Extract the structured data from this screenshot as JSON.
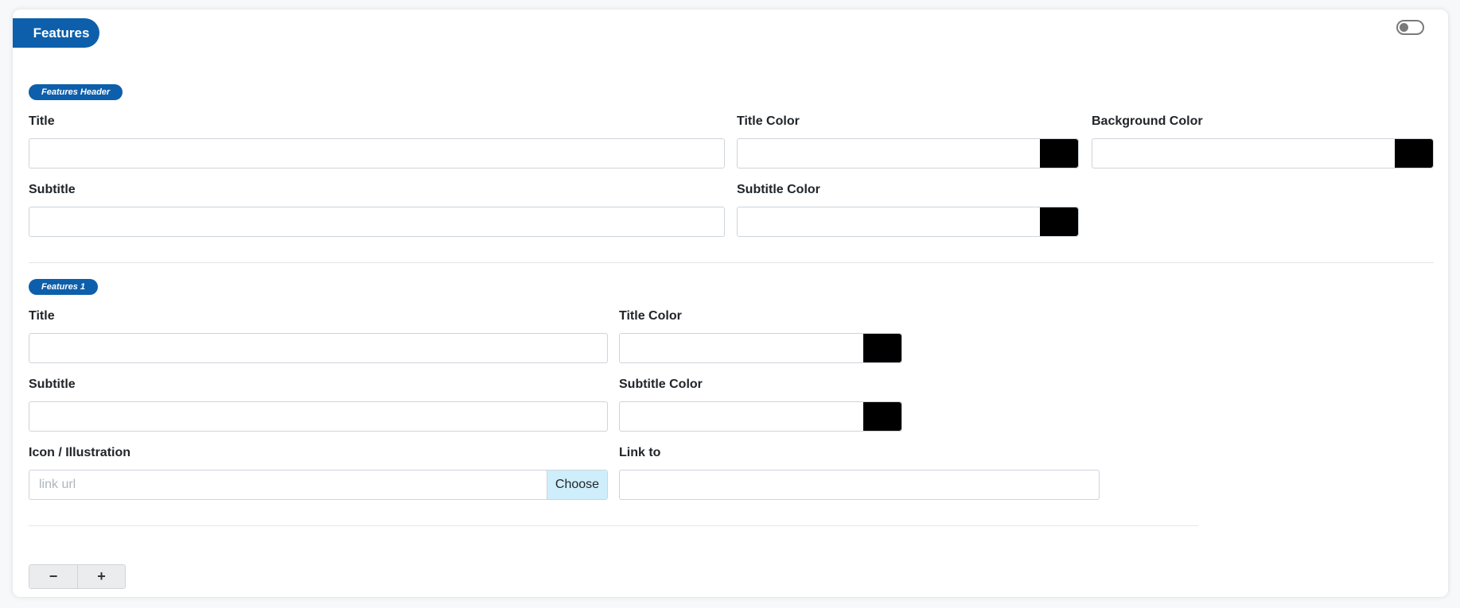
{
  "card": {
    "title": "Features",
    "toggle_state": "off"
  },
  "header_section": {
    "badge": "Features Header",
    "title_label": "Title",
    "title_value": "",
    "title_color_label": "Title Color",
    "title_color_value": "",
    "title_color_swatch": "#000000",
    "background_color_label": "Background Color",
    "background_color_value": "",
    "background_color_swatch": "#000000",
    "subtitle_label": "Subtitle",
    "subtitle_value": "",
    "subtitle_color_label": "Subtitle Color",
    "subtitle_color_value": "",
    "subtitle_color_swatch": "#000000"
  },
  "feature_1": {
    "badge": "Features 1",
    "title_label": "Title",
    "title_value": "",
    "title_color_label": "Title Color",
    "title_color_value": "",
    "title_color_swatch": "#000000",
    "subtitle_label": "Subtitle",
    "subtitle_value": "",
    "subtitle_color_label": "Subtitle Color",
    "subtitle_color_value": "",
    "subtitle_color_swatch": "#000000",
    "icon_label": "Icon / Illustration",
    "icon_placeholder": "link url",
    "choose_label": "Choose",
    "link_label": "Link to",
    "link_value": ""
  },
  "stepper": {
    "minus": "−",
    "plus": "+"
  },
  "colors": {
    "accent": "#0d5fab",
    "choose_bg": "#cfeefb"
  }
}
